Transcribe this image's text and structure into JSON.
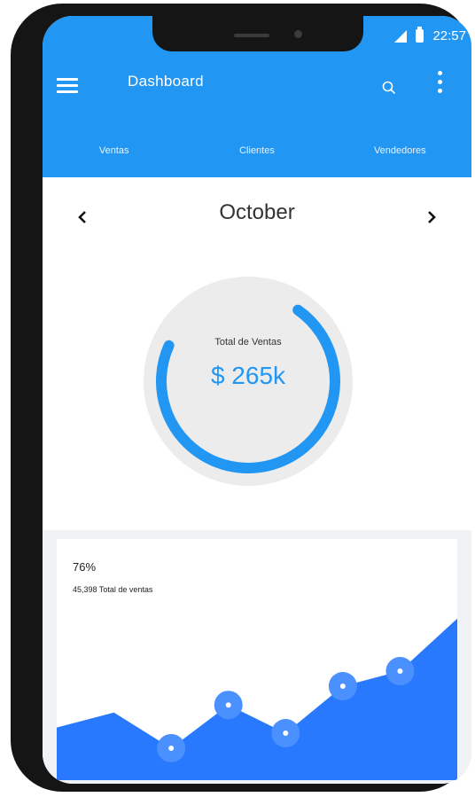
{
  "status_bar": {
    "time": "22:57"
  },
  "app_bar": {
    "title": "Dashboard"
  },
  "tabs": [
    {
      "label": "Ventas"
    },
    {
      "label": "Clientes"
    },
    {
      "label": "Vendedores"
    }
  ],
  "selected_tab": "Ventas",
  "month_nav": {
    "month": "October"
  },
  "gauge": {
    "label": "Total de Ventas",
    "value": "$ 265k",
    "progress": 0.72
  },
  "card": {
    "percentage": "76%",
    "subtitle": "45,398 Total de ventas"
  },
  "chart_data": {
    "type": "area",
    "x": [
      1,
      2,
      3,
      4,
      5,
      6,
      7,
      8
    ],
    "values": [
      28,
      36,
      17,
      40,
      25,
      50,
      58,
      86
    ],
    "markers": [
      2,
      3,
      4,
      5,
      6
    ],
    "ylim": [
      0,
      100
    ],
    "color": "#2979ff"
  },
  "colors": {
    "accent": "#2196f3",
    "chart_fill": "#2979ff",
    "marker": "#4a90ff",
    "gauge_bg": "#ececec"
  }
}
